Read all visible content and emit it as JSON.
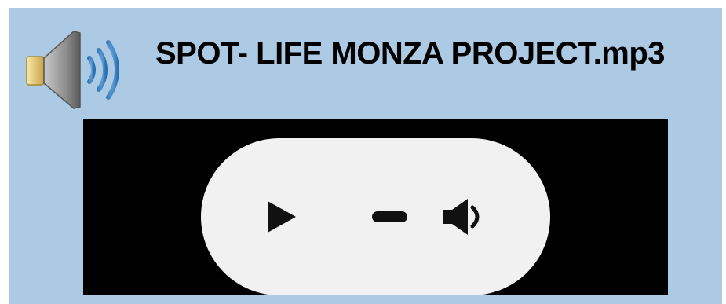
{
  "file": {
    "name": "SPOT- LIFE MONZA PROJECT.mp3",
    "icon": "speaker-audio-icon"
  },
  "player": {
    "play_icon": "play-icon",
    "progress": 0,
    "volume_icon": "volume-icon"
  },
  "colors": {
    "panel_background": "#adcae4",
    "player_background": "#000000",
    "controls_background": "#f1f1f1",
    "control_glyph": "#111111"
  }
}
